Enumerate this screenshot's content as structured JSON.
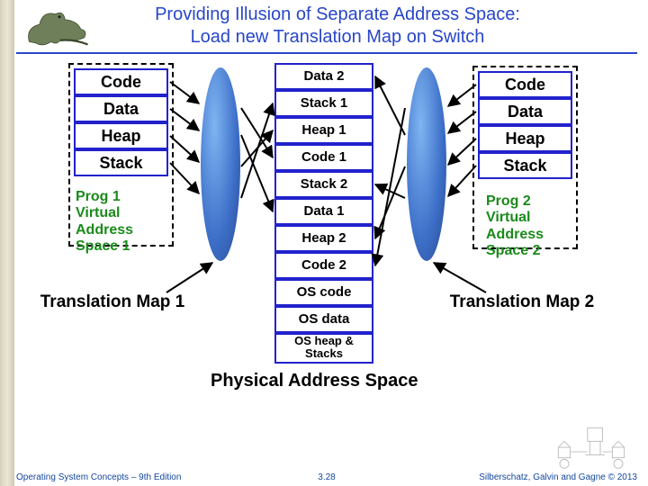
{
  "title_line1": "Providing Illusion of Separate Address Space:",
  "title_line2": "Load new Translation Map on Switch",
  "left_virtual": {
    "segments": [
      "Code",
      "Data",
      "Heap",
      "Stack"
    ],
    "caption_line1": "Prog 1",
    "caption_line2": "Virtual",
    "caption_line3": "Address",
    "caption_line4": "Space 1"
  },
  "right_virtual": {
    "segments": [
      "Code",
      "Data",
      "Heap",
      "Stack"
    ],
    "caption_line1": "Prog 2",
    "caption_line2": "Virtual",
    "caption_line3": "Address",
    "caption_line4": "Space 2"
  },
  "physical": {
    "segments": [
      "Data 2",
      "Stack 1",
      "Heap 1",
      "Code 1",
      "Stack 2",
      "Data 1",
      "Heap 2",
      "Code 2",
      "OS code",
      "OS data",
      "OS heap & Stacks"
    ],
    "caption": "Physical Address Space"
  },
  "translation_left": "Translation Map 1",
  "translation_right": "Translation Map 2",
  "footer": {
    "left": "Operating System Concepts – 9th Edition",
    "mid": "3.28",
    "right": "Silberschatz, Galvin and Gagne © 2013"
  }
}
